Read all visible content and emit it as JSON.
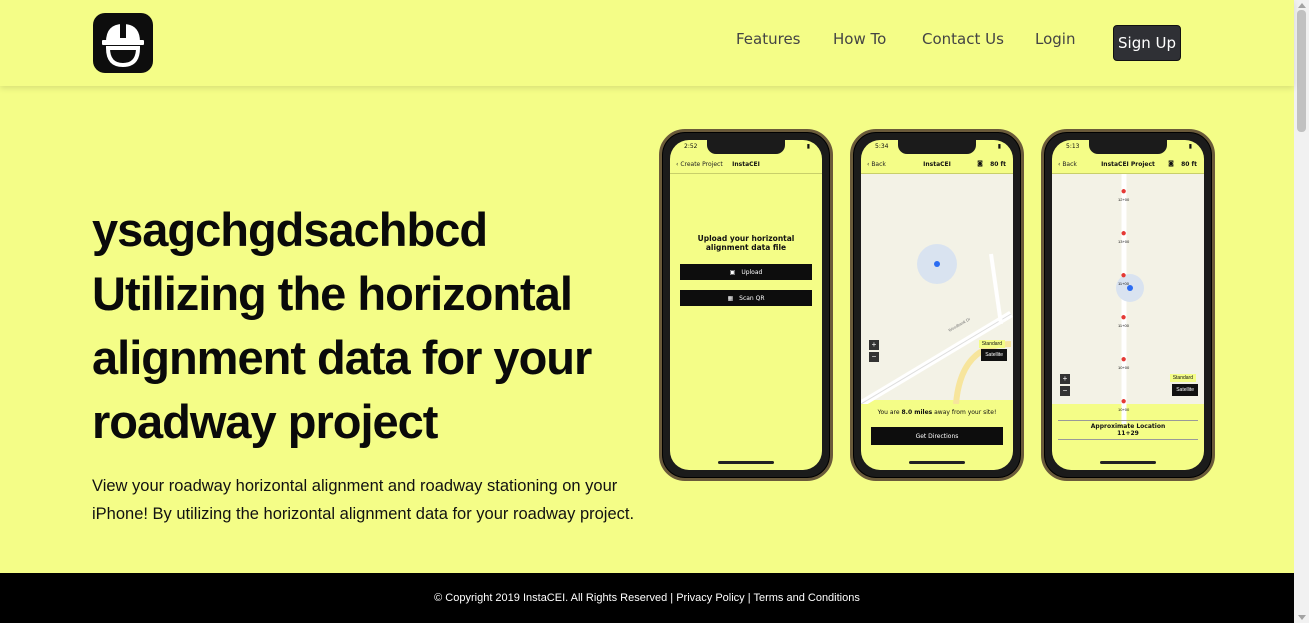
{
  "nav": {
    "links": [
      "Features",
      "How To",
      "Contact Us",
      "Login"
    ],
    "signup_label": "Sign Up"
  },
  "hero": {
    "title_lines": [
      "ysagchgdsachbcd",
      "Utilizing the horizontal",
      "alignment data for your",
      "roadway project"
    ],
    "description": "View your roadway horizontal alignment and roadway stationing on your iPhone! By utilizing the horizontal alignment data for your roadway project."
  },
  "phones": {
    "phone1": {
      "time": "2:52",
      "back": "Create Project",
      "title": "InstaCEI",
      "heading": "Upload your horizontal alignment data file",
      "upload_label": "Upload",
      "scan_label": "Scan QR"
    },
    "phone2": {
      "time": "5:34",
      "back": "Back",
      "title": "InstaCEI",
      "right": "80 ft",
      "street": "Woodbank Dr",
      "standard": "Standard",
      "satellite": "Satellite",
      "distance_prefix": "You are ",
      "distance_value": "8.0 miles",
      "distance_suffix": " away from your site!",
      "directions_label": "Get Directions"
    },
    "phone3": {
      "time": "5:13",
      "back": "Back",
      "title": "InstaCEI Project",
      "right": "80 ft",
      "standard": "Standard",
      "satellite": "Satellite",
      "approx_label": "Approximate Location",
      "approx_value": "11+29",
      "stations": [
        "12+00",
        "13+00",
        "11+00",
        "11+00",
        "10+00",
        "10+00"
      ]
    }
  },
  "footer": {
    "copyright": "© Copyright 2019 InstaCEI. All Rights Reserved | ",
    "privacy": "Privacy Policy",
    "sep": " | ",
    "terms": "Terms and Conditions"
  },
  "colors": {
    "background": "#f4fd87",
    "dark": "#0d0d0d",
    "signup": "#2f3035"
  }
}
